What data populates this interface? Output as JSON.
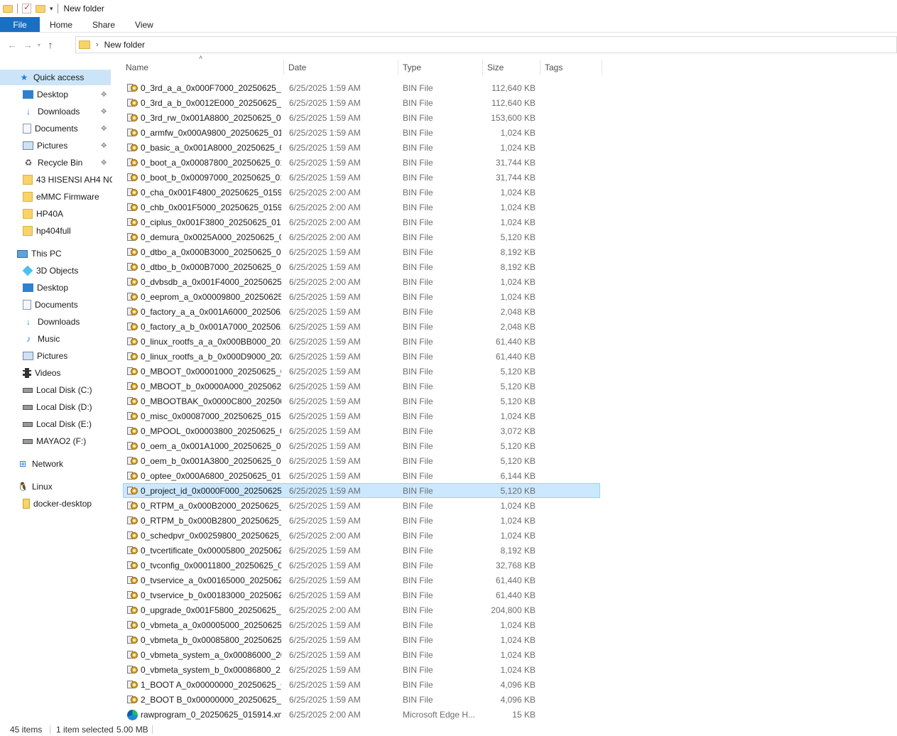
{
  "window": {
    "title": "New folder"
  },
  "ribbon": {
    "file": "File",
    "tabs": [
      "Home",
      "Share",
      "View"
    ]
  },
  "address": {
    "crumbs": [
      "New folder"
    ]
  },
  "sidebar": {
    "items": [
      {
        "label": "Quick access",
        "icon": "star-icon",
        "selected": true
      },
      {
        "label": "Desktop",
        "icon": "desktop-icon",
        "pinned": true
      },
      {
        "label": "Downloads",
        "icon": "download-icon",
        "pinned": true
      },
      {
        "label": "Documents",
        "icon": "documents-icon",
        "pinned": true
      },
      {
        "label": "Pictures",
        "icon": "pictures-icon",
        "pinned": true
      },
      {
        "label": "Recycle Bin",
        "icon": "recycle-bin-icon",
        "pinned": true
      },
      {
        "label": "43 HISENSI AH4 NG",
        "icon": "folder-icon"
      },
      {
        "label": "eMMC Firmware",
        "icon": "folder-icon"
      },
      {
        "label": "HP40A",
        "icon": "folder-icon"
      },
      {
        "label": "hp404full",
        "icon": "folder-icon"
      },
      {
        "label": "This PC",
        "icon": "pc-icon"
      },
      {
        "label": "3D Objects",
        "icon": "3d-objects-icon"
      },
      {
        "label": "Desktop",
        "icon": "desktop-icon"
      },
      {
        "label": "Documents",
        "icon": "documents-icon"
      },
      {
        "label": "Downloads",
        "icon": "download-icon"
      },
      {
        "label": "Music",
        "icon": "music-icon"
      },
      {
        "label": "Pictures",
        "icon": "pictures-icon"
      },
      {
        "label": "Videos",
        "icon": "videos-icon"
      },
      {
        "label": "Local Disk (C:)",
        "icon": "drive-icon"
      },
      {
        "label": "Local Disk (D:)",
        "icon": "drive-icon"
      },
      {
        "label": "Local Disk (E:)",
        "icon": "drive-icon"
      },
      {
        "label": "MAYAO2 (F:)",
        "icon": "drive-icon"
      },
      {
        "label": "Network",
        "icon": "network-icon"
      },
      {
        "label": "Linux",
        "icon": "linux-icon"
      },
      {
        "label": "docker-desktop",
        "icon": "docker-folder-icon"
      }
    ]
  },
  "columns": {
    "name": "Name",
    "date": "Date",
    "type": "Type",
    "size": "Size",
    "tags": "Tags"
  },
  "files": [
    {
      "name": "0_3rd_a_a_0x000F7000_20250625_01...",
      "date": "6/25/2025 1:59 AM",
      "type": "BIN File",
      "size": "112,640 KB"
    },
    {
      "name": "0_3rd_a_b_0x0012E000_20250625_01...",
      "date": "6/25/2025 1:59 AM",
      "type": "BIN File",
      "size": "112,640 KB"
    },
    {
      "name": "0_3rd_rw_0x001A8800_20250625_01...",
      "date": "6/25/2025 1:59 AM",
      "type": "BIN File",
      "size": "153,600 KB"
    },
    {
      "name": "0_armfw_0x000A9800_20250625_01...",
      "date": "6/25/2025 1:59 AM",
      "type": "BIN File",
      "size": "1,024 KB"
    },
    {
      "name": "0_basic_a_0x001A8000_20250625_01...",
      "date": "6/25/2025 1:59 AM",
      "type": "BIN File",
      "size": "1,024 KB"
    },
    {
      "name": "0_boot_a_0x00087800_20250625_01...",
      "date": "6/25/2025 1:59 AM",
      "type": "BIN File",
      "size": "31,744 KB"
    },
    {
      "name": "0_boot_b_0x00097000_20250625_01...",
      "date": "6/25/2025 1:59 AM",
      "type": "BIN File",
      "size": "31,744 KB"
    },
    {
      "name": "0_cha_0x001F4800_20250625_01591...",
      "date": "6/25/2025 2:00 AM",
      "type": "BIN File",
      "size": "1,024 KB"
    },
    {
      "name": "0_chb_0x001F5000_20250625_01591...",
      "date": "6/25/2025 2:00 AM",
      "type": "BIN File",
      "size": "1,024 KB"
    },
    {
      "name": "0_ciplus_0x001F3800_20250625_015...",
      "date": "6/25/2025 2:00 AM",
      "type": "BIN File",
      "size": "1,024 KB"
    },
    {
      "name": "0_demura_0x0025A000_20250625_0...",
      "date": "6/25/2025 2:00 AM",
      "type": "BIN File",
      "size": "5,120 KB"
    },
    {
      "name": "0_dtbo_a_0x000B3000_20250625_01...",
      "date": "6/25/2025 1:59 AM",
      "type": "BIN File",
      "size": "8,192 KB"
    },
    {
      "name": "0_dtbo_b_0x000B7000_20250625_01...",
      "date": "6/25/2025 1:59 AM",
      "type": "BIN File",
      "size": "8,192 KB"
    },
    {
      "name": "0_dvbsdb_a_0x001F4000_20250625_...",
      "date": "6/25/2025 2:00 AM",
      "type": "BIN File",
      "size": "1,024 KB"
    },
    {
      "name": "0_eeprom_a_0x00009800_20250625_...",
      "date": "6/25/2025 1:59 AM",
      "type": "BIN File",
      "size": "1,024 KB"
    },
    {
      "name": "0_factory_a_a_0x001A6000_2025062...",
      "date": "6/25/2025 1:59 AM",
      "type": "BIN File",
      "size": "2,048 KB"
    },
    {
      "name": "0_factory_a_b_0x001A7000_2025062...",
      "date": "6/25/2025 1:59 AM",
      "type": "BIN File",
      "size": "2,048 KB"
    },
    {
      "name": "0_linux_rootfs_a_a_0x000BB000_202...",
      "date": "6/25/2025 1:59 AM",
      "type": "BIN File",
      "size": "61,440 KB"
    },
    {
      "name": "0_linux_rootfs_a_b_0x000D9000_202...",
      "date": "6/25/2025 1:59 AM",
      "type": "BIN File",
      "size": "61,440 KB"
    },
    {
      "name": "0_MBOOT_0x00001000_20250625_0...",
      "date": "6/25/2025 1:59 AM",
      "type": "BIN File",
      "size": "5,120 KB"
    },
    {
      "name": "0_MBOOT_b_0x0000A000_20250625...",
      "date": "6/25/2025 1:59 AM",
      "type": "BIN File",
      "size": "5,120 KB"
    },
    {
      "name": "0_MBOOTBAK_0x0000C800_202506...",
      "date": "6/25/2025 1:59 AM",
      "type": "BIN File",
      "size": "5,120 KB"
    },
    {
      "name": "0_misc_0x00087000_20250625_0159...",
      "date": "6/25/2025 1:59 AM",
      "type": "BIN File",
      "size": "1,024 KB"
    },
    {
      "name": "0_MPOOL_0x00003800_20250625_0...",
      "date": "6/25/2025 1:59 AM",
      "type": "BIN File",
      "size": "3,072 KB"
    },
    {
      "name": "0_oem_a_0x001A1000_20250625_01...",
      "date": "6/25/2025 1:59 AM",
      "type": "BIN File",
      "size": "5,120 KB"
    },
    {
      "name": "0_oem_b_0x001A3800_20250625_01...",
      "date": "6/25/2025 1:59 AM",
      "type": "BIN File",
      "size": "5,120 KB"
    },
    {
      "name": "0_optee_0x000A6800_20250625_015...",
      "date": "6/25/2025 1:59 AM",
      "type": "BIN File",
      "size": "6,144 KB"
    },
    {
      "name": "0_project_id_0x0000F000_20250625_...",
      "date": "6/25/2025 1:59 AM",
      "type": "BIN File",
      "size": "5,120 KB",
      "selected": true
    },
    {
      "name": "0_RTPM_a_0x000B2000_20250625_0...",
      "date": "6/25/2025 1:59 AM",
      "type": "BIN File",
      "size": "1,024 KB"
    },
    {
      "name": "0_RTPM_b_0x000B2800_20250625_0...",
      "date": "6/25/2025 1:59 AM",
      "type": "BIN File",
      "size": "1,024 KB"
    },
    {
      "name": "0_schedpvr_0x00259800_20250625_...",
      "date": "6/25/2025 2:00 AM",
      "type": "BIN File",
      "size": "1,024 KB"
    },
    {
      "name": "0_tvcertificate_0x00005800_2025062...",
      "date": "6/25/2025 1:59 AM",
      "type": "BIN File",
      "size": "8,192 KB"
    },
    {
      "name": "0_tvconfig_0x00011800_20250625_0...",
      "date": "6/25/2025 1:59 AM",
      "type": "BIN File",
      "size": "32,768 KB"
    },
    {
      "name": "0_tvservice_a_0x00165000_20250625...",
      "date": "6/25/2025 1:59 AM",
      "type": "BIN File",
      "size": "61,440 KB"
    },
    {
      "name": "0_tvservice_b_0x00183000_2025062...",
      "date": "6/25/2025 1:59 AM",
      "type": "BIN File",
      "size": "61,440 KB"
    },
    {
      "name": "0_upgrade_0x001F5800_20250625_0...",
      "date": "6/25/2025 2:00 AM",
      "type": "BIN File",
      "size": "204,800 KB"
    },
    {
      "name": "0_vbmeta_a_0x00005000_20250625_...",
      "date": "6/25/2025 1:59 AM",
      "type": "BIN File",
      "size": "1,024 KB"
    },
    {
      "name": "0_vbmeta_b_0x00085800_20250625_...",
      "date": "6/25/2025 1:59 AM",
      "type": "BIN File",
      "size": "1,024 KB"
    },
    {
      "name": "0_vbmeta_system_a_0x00086000_20...",
      "date": "6/25/2025 1:59 AM",
      "type": "BIN File",
      "size": "1,024 KB"
    },
    {
      "name": "0_vbmeta_system_b_0x00086800_2...",
      "date": "6/25/2025 1:59 AM",
      "type": "BIN File",
      "size": "1,024 KB"
    },
    {
      "name": "1_BOOT A_0x00000000_20250625_0...",
      "date": "6/25/2025 1:59 AM",
      "type": "BIN File",
      "size": "4,096 KB"
    },
    {
      "name": "2_BOOT B_0x00000000_20250625_01...",
      "date": "6/25/2025 1:59 AM",
      "type": "BIN File",
      "size": "4,096 KB"
    },
    {
      "name": "rawprogram_0_20250625_015914.xml",
      "date": "6/25/2025 2:00 AM",
      "type": "Microsoft Edge H...",
      "size": "15 KB",
      "icon": "edge"
    }
  ],
  "status": {
    "count": "45 items",
    "selection": "1 item selected",
    "size": "5.00 MB"
  }
}
